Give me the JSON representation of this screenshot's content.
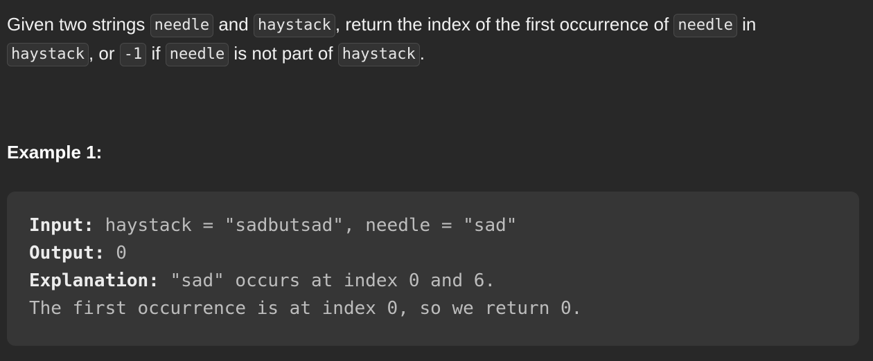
{
  "problem": {
    "text_1": "Given two strings ",
    "code_needle": "needle",
    "text_2": " and ",
    "code_haystack": "haystack",
    "text_3": ", return the index of the first occurrence of ",
    "text_4": " in ",
    "text_5": ", or ",
    "code_minus_one": "-1",
    "text_6": " if ",
    "text_7": " is not part of ",
    "text_8": "."
  },
  "example": {
    "title": "Example 1:",
    "input_label": "Input:",
    "input_value": " haystack = \"sadbutsad\", needle = \"sad\"",
    "output_label": "Output:",
    "output_value": " 0",
    "explanation_label": "Explanation:",
    "explanation_value": " \"sad\" occurs at index 0 and 6.",
    "explanation_line2": "The first occurrence is at index 0, so we return 0."
  }
}
